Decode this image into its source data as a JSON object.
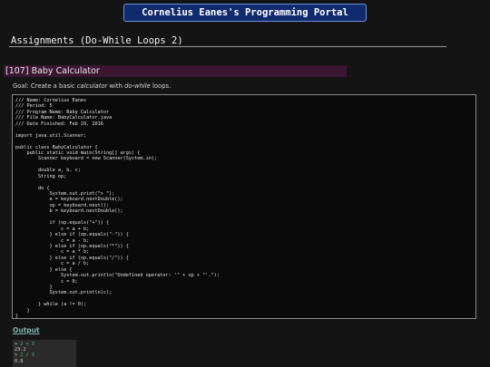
{
  "header": {
    "portal_title": "Cornelius Eanes's Programming Portal"
  },
  "page": {
    "heading": "Assignments (Do-While Loops 2)"
  },
  "assignment": {
    "title": "[107] Baby Calculator",
    "goal_prefix": "Goal: Create a basic ",
    "goal_emphasis": "calculator",
    "goal_suffix": " with ",
    "goal_emphasis2": "do-while",
    "goal_end": " loops."
  },
  "code_lines": [
    "/// Name: Cornelius Eanes",
    "/// Period: 5",
    "/// Program Name: Baby Calculator",
    "/// File Name: BabyCalculator.java",
    "/// Date Finished: Feb 29, 2016",
    "",
    "import java.util.Scanner;",
    "",
    "public class BabyCalculator {",
    "    public static void main(String[] args) {",
    "        Scanner keyboard = new Scanner(System.in);",
    "",
    "        double a, b, c;",
    "        String op;",
    "",
    "        do {",
    "            System.out.print(\"> \");",
    "            a = keyboard.nextDouble();",
    "            op = keyboard.next();",
    "            b = keyboard.nextDouble();",
    "",
    "            if (op.equals(\"+\")) {",
    "                c = a + b;",
    "            } else if (op.equals(\"-\")) {",
    "                c = a - b;",
    "            } else if (op.equals(\"*\")) {",
    "                c = a * b;",
    "            } else if (op.equals(\"/\")) {",
    "                c = a / b;",
    "            } else {",
    "                System.out.println(\"Undefined operator: '\" + op + \"'.\");",
    "                c = 0;",
    "            }",
    "            System.out.println(c);",
    "",
    "        } while (a != 0);",
    "    }",
    "}"
  ],
  "output": {
    "link_label": "Output",
    "lines": [
      {
        "prompt": "> ",
        "input": "2 + 3"
      },
      {
        "prompt": "",
        "input": "",
        "text": "23.2"
      },
      {
        "prompt": "> ",
        "input": "2 / 3"
      },
      {
        "prompt": "",
        "input": "",
        "text": "0.8"
      }
    ]
  }
}
